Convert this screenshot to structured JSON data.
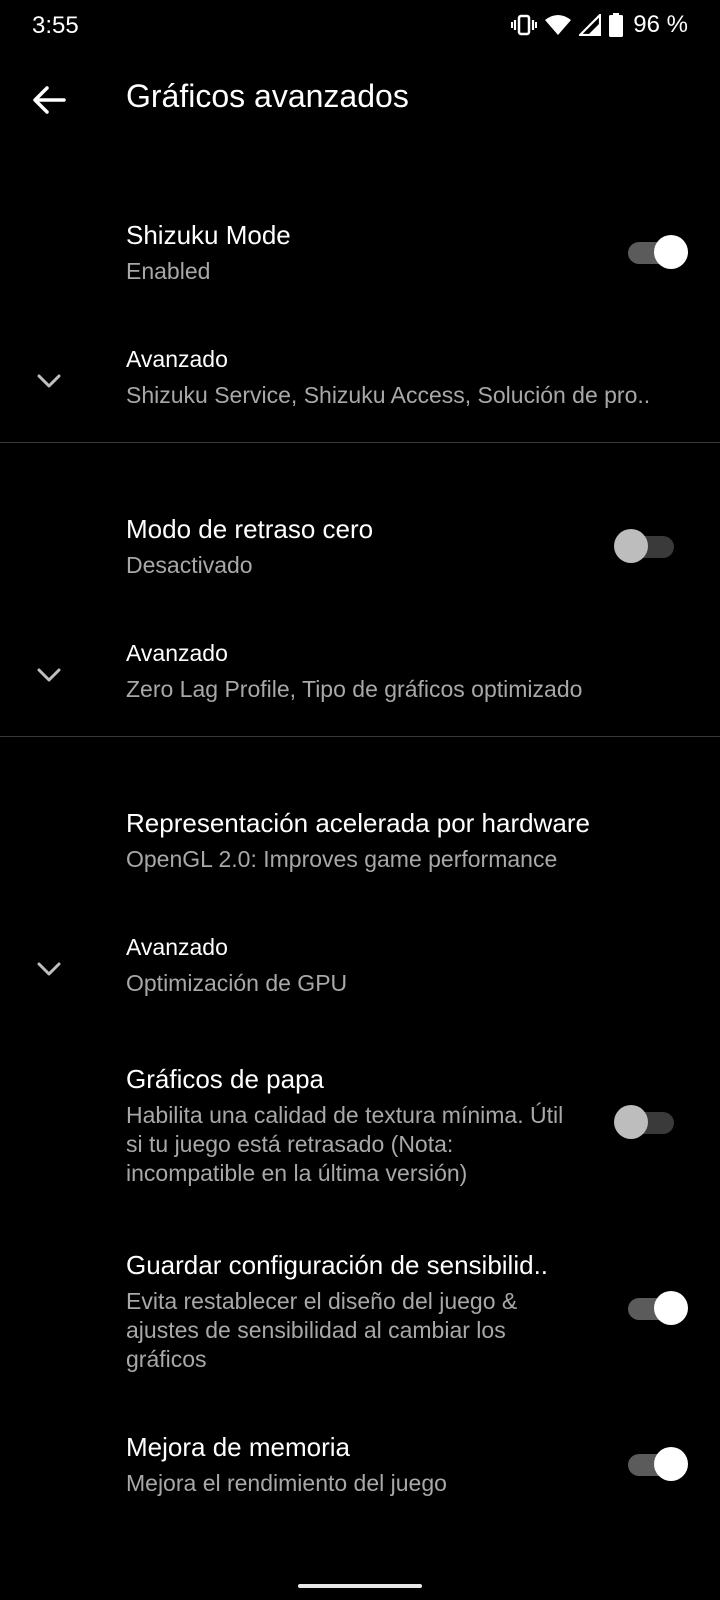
{
  "status_bar": {
    "time": "3:55",
    "battery": "96 %",
    "icons": [
      "vibrate-icon",
      "wifi-icon",
      "signal-icon",
      "battery-icon"
    ]
  },
  "app_bar": {
    "back_icon": "arrow-back-icon",
    "title": "Gráficos avanzados"
  },
  "sections": {
    "shizuku": {
      "title": "Shizuku Mode",
      "subtitle": "Enabled",
      "toggle_on": true,
      "advanced_label": "Avanzado",
      "advanced_summary": "Shizuku Service, Shizuku Access, Solución de pro.."
    },
    "zero_lag": {
      "title": "Modo de retraso cero",
      "subtitle": "Desactivado",
      "toggle_on": false,
      "advanced_label": "Avanzado",
      "advanced_summary": "Zero Lag Profile, Tipo de gráficos optimizado"
    },
    "hardware": {
      "title": "Representación acelerada por hardware",
      "subtitle": "OpenGL 2.0: Improves game performance",
      "advanced_label": "Avanzado",
      "advanced_summary": "Optimización de GPU"
    },
    "potato": {
      "title": "Gráficos de papa",
      "subtitle": "Habilita una calidad de textura mínima. Útil si tu juego está retrasado (Nota: incompatible en la última versión)",
      "toggle_on": false
    },
    "save_config": {
      "title": "Guardar configuración de sensibilid..",
      "subtitle": "Evita restablecer el diseño del juego & ajustes de sensibilidad al cambiar los gráficos",
      "toggle_on": true
    },
    "memory": {
      "title": "Mejora de memoria",
      "subtitle": "Mejora el rendimiento del juego",
      "toggle_on": true
    }
  },
  "colors": {
    "background": "#000000",
    "secondary_text": "#a8a8a8",
    "toggle_track_on": "#5b5b5b",
    "toggle_thumb_on": "#ffffff",
    "toggle_thumb_off": "#bdbdbd"
  }
}
